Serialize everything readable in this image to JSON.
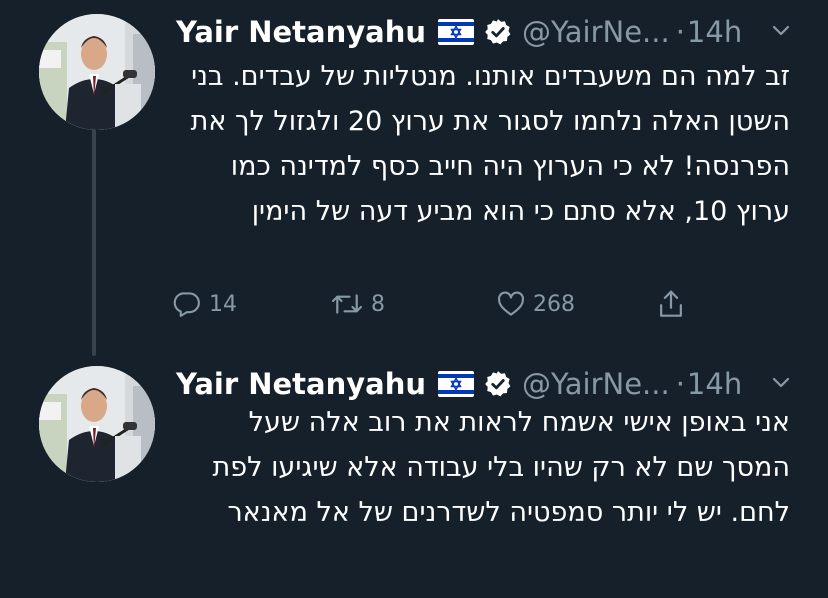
{
  "tweets": [
    {
      "author_name": "Yair Netanyahu",
      "handle": "@YairNe...",
      "separator": "·",
      "time": "14h",
      "text": "זב למה הם משעבדים אותנו. מנטליות של עבדים. בני השטן האלה נלחמו לסגור את ערוץ 20 ולגזול לך את הפרנסה! לא כי הערוץ היה חייב כסף למדינה כמו ערוץ 10, אלא סתם כי הוא מביע דעה של הימין",
      "replies": "14",
      "retweets": "8",
      "likes": "268"
    },
    {
      "author_name": "Yair Netanyahu",
      "handle": "@YairNe...",
      "separator": "·",
      "time": "14h",
      "text": "אני באופן אישי אשמח לראות את רוב אלה שעל המסך שם לא רק שהיו בלי עבודה אלא שיגיעו לפת לחם. יש לי יותר סמפטיה לשדרנים של אל מאנאר"
    }
  ],
  "icons": {
    "flag": "israel-flag-icon",
    "verified": "verified-badge-icon",
    "menu": "chevron-down-icon",
    "reply": "reply-icon",
    "retweet": "retweet-icon",
    "like": "heart-icon",
    "share": "share-icon"
  },
  "colors": {
    "background": "#15202b",
    "secondary_text": "#8899a6",
    "thread_line": "#38444d",
    "flag_blue": "#0038b8"
  }
}
